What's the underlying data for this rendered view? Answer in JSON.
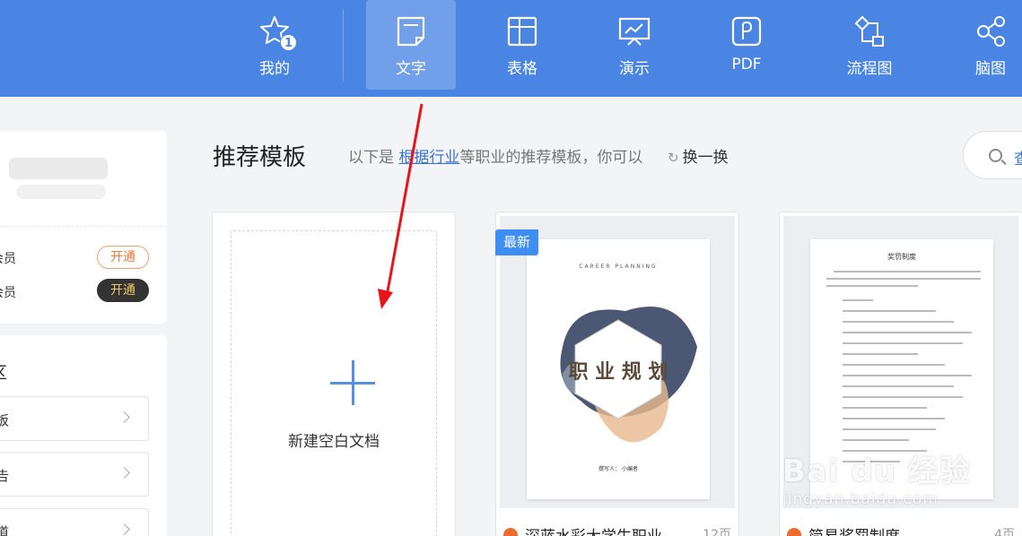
{
  "topnav": {
    "items": [
      {
        "label": "我的",
        "icon": "star-icon",
        "badge": "1"
      },
      {
        "label": "文字",
        "icon": "document-icon",
        "active": true
      },
      {
        "label": "表格",
        "icon": "table-icon"
      },
      {
        "label": "演示",
        "icon": "presentation-icon"
      },
      {
        "label": "PDF",
        "icon": "pdf-icon"
      },
      {
        "label": "流程图",
        "icon": "flowchart-icon"
      },
      {
        "label": "脑图",
        "icon": "mindmap-icon"
      }
    ]
  },
  "sidebar": {
    "members": [
      {
        "label": "会员",
        "button": "开通",
        "style": "outline"
      },
      {
        "label": "会员",
        "button": "开通",
        "style": "dark"
      }
    ],
    "zone_title": "区",
    "links": [
      "板",
      "告",
      "道"
    ]
  },
  "main": {
    "title": "推荐模板",
    "subtitle_prefix": "以下是",
    "subtitle_link": "根据行业",
    "subtitle_suffix": "等职业的推荐模板，你可以",
    "refresh_label": "换一换",
    "search_text": "查"
  },
  "cards": {
    "new_doc_label": "新建空白文档",
    "templates": [
      {
        "tag": "最新",
        "title": "深蓝水彩大学生职业",
        "pages": "12页",
        "cover_header": "CAREER PLANNING",
        "cover_text": "职 业 规 划",
        "cover_footer": "撰写人：  小编者"
      },
      {
        "title": "简易奖罚制度",
        "pages": "4页",
        "cover_header": "奖罚制度"
      }
    ]
  },
  "watermark": {
    "line1": "Bai du 经验",
    "line2": "jingyan.baidu.com"
  },
  "colors": {
    "topbar": "#4a85e4",
    "accent": "#3e8df3",
    "arrow": "#e8141a"
  }
}
